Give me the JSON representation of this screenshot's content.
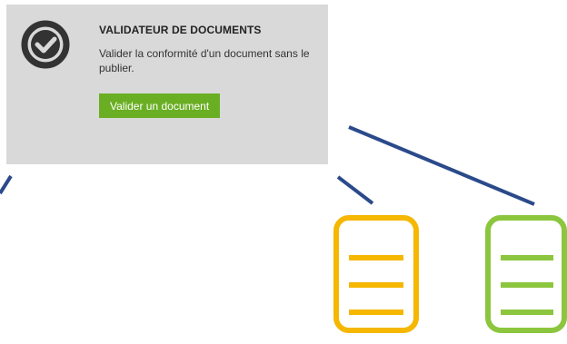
{
  "colors": {
    "card_background": "#d9d9d9",
    "button_background": "#6aaf23",
    "connector_line": "#2b4a8b",
    "doc_yellow": "#f5b700",
    "doc_green": "#8cc63f",
    "icon_dark": "#333333"
  },
  "icons": {
    "check": "check-circle-icon",
    "doc_yellow": "document-icon",
    "doc_green": "document-icon"
  },
  "card": {
    "title": "VALIDATEUR DE DOCUMENTS",
    "description": "Valider la conformité d'un document sans le publier.",
    "button_label": "Valider un document"
  }
}
